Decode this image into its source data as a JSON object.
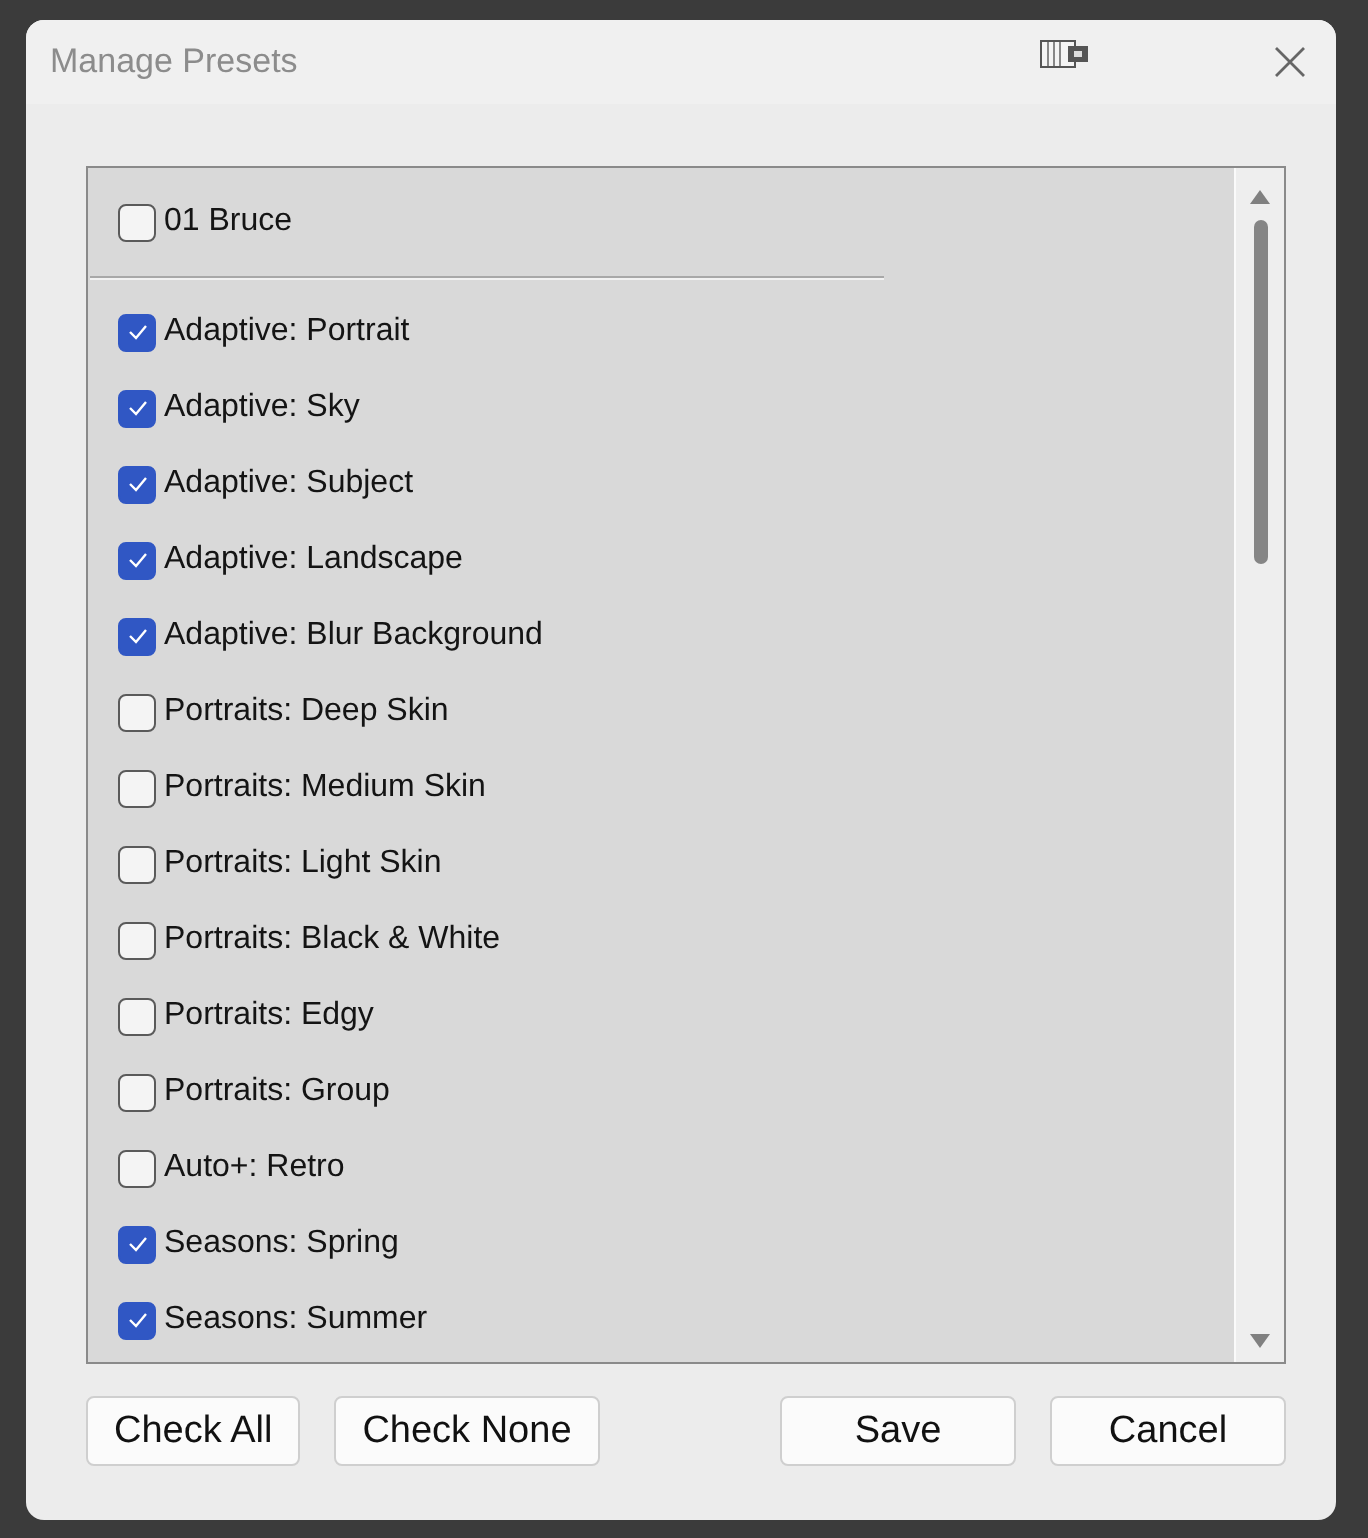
{
  "window": {
    "title": "Manage Presets"
  },
  "presets": {
    "header_item": {
      "label": "01 Bruce",
      "checked": false
    },
    "items": [
      {
        "label": "Adaptive: Portrait",
        "checked": true
      },
      {
        "label": "Adaptive: Sky",
        "checked": true
      },
      {
        "label": "Adaptive: Subject",
        "checked": true
      },
      {
        "label": "Adaptive: Landscape",
        "checked": true
      },
      {
        "label": "Adaptive: Blur Background",
        "checked": true
      },
      {
        "label": "Portraits: Deep Skin",
        "checked": false
      },
      {
        "label": "Portraits: Medium Skin",
        "checked": false
      },
      {
        "label": "Portraits: Light Skin",
        "checked": false
      },
      {
        "label": "Portraits: Black & White",
        "checked": false
      },
      {
        "label": "Portraits: Edgy",
        "checked": false
      },
      {
        "label": "Portraits: Group",
        "checked": false
      },
      {
        "label": "Auto+: Retro",
        "checked": false
      },
      {
        "label": "Seasons: Spring",
        "checked": true
      },
      {
        "label": "Seasons: Summer",
        "checked": true
      }
    ]
  },
  "left_buttons": [
    "Check All",
    "Check None"
  ],
  "right_buttons": [
    "Save",
    "Cancel"
  ]
}
